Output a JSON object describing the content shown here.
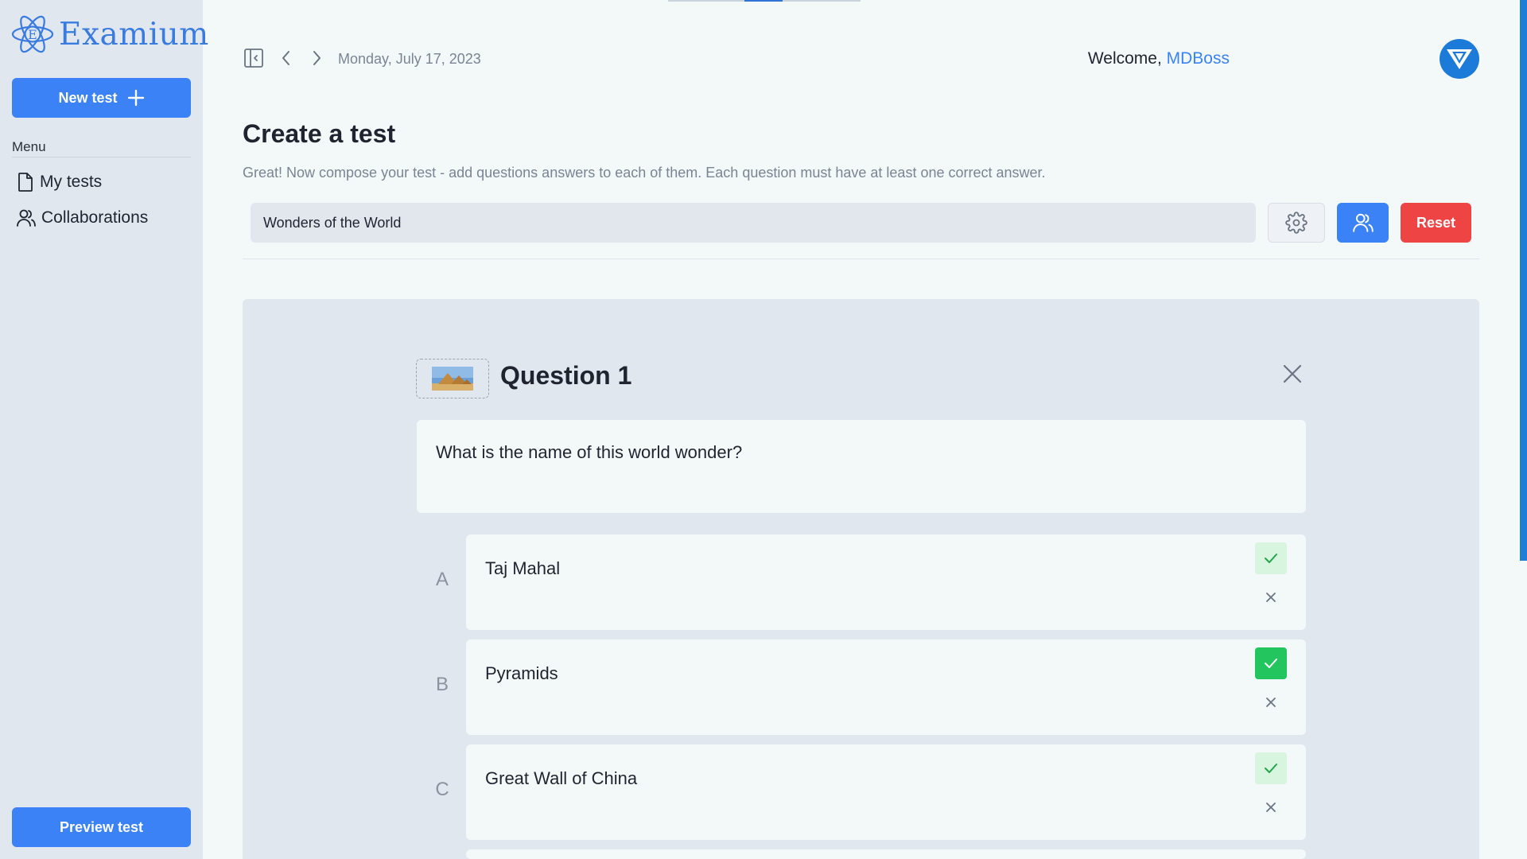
{
  "app": {
    "name": "Examium",
    "logo_letter": "E"
  },
  "sidebar": {
    "new_test_label": "New test",
    "menu_label": "Menu",
    "items": [
      {
        "label": "My tests",
        "icon": "file-icon"
      },
      {
        "label": "Collaborations",
        "icon": "users-icon"
      }
    ],
    "preview_label": "Preview test"
  },
  "header": {
    "date": "Monday, July 17, 2023",
    "welcome_prefix": "Welcome, ",
    "username": "MDBoss"
  },
  "progress": {
    "fraction": 0.2
  },
  "page": {
    "title": "Create a test",
    "subtitle": "Great! Now compose your test - add questions answers to each of them. Each question must have at least one correct answer."
  },
  "test": {
    "title_value": "Wonders of the World",
    "reset_label": "Reset"
  },
  "question": {
    "title": "Question 1",
    "text": "What is the name of this world wonder?",
    "answers": [
      {
        "letter": "A",
        "text": "Taj Mahal",
        "correct": false
      },
      {
        "letter": "B",
        "text": "Pyramids",
        "correct": true
      },
      {
        "letter": "C",
        "text": "Great Wall of China",
        "correct": false
      }
    ]
  },
  "colors": {
    "accent": "#3b82f6",
    "danger": "#ef4444",
    "success": "#22c55e",
    "success_light": "#d7f5df"
  }
}
